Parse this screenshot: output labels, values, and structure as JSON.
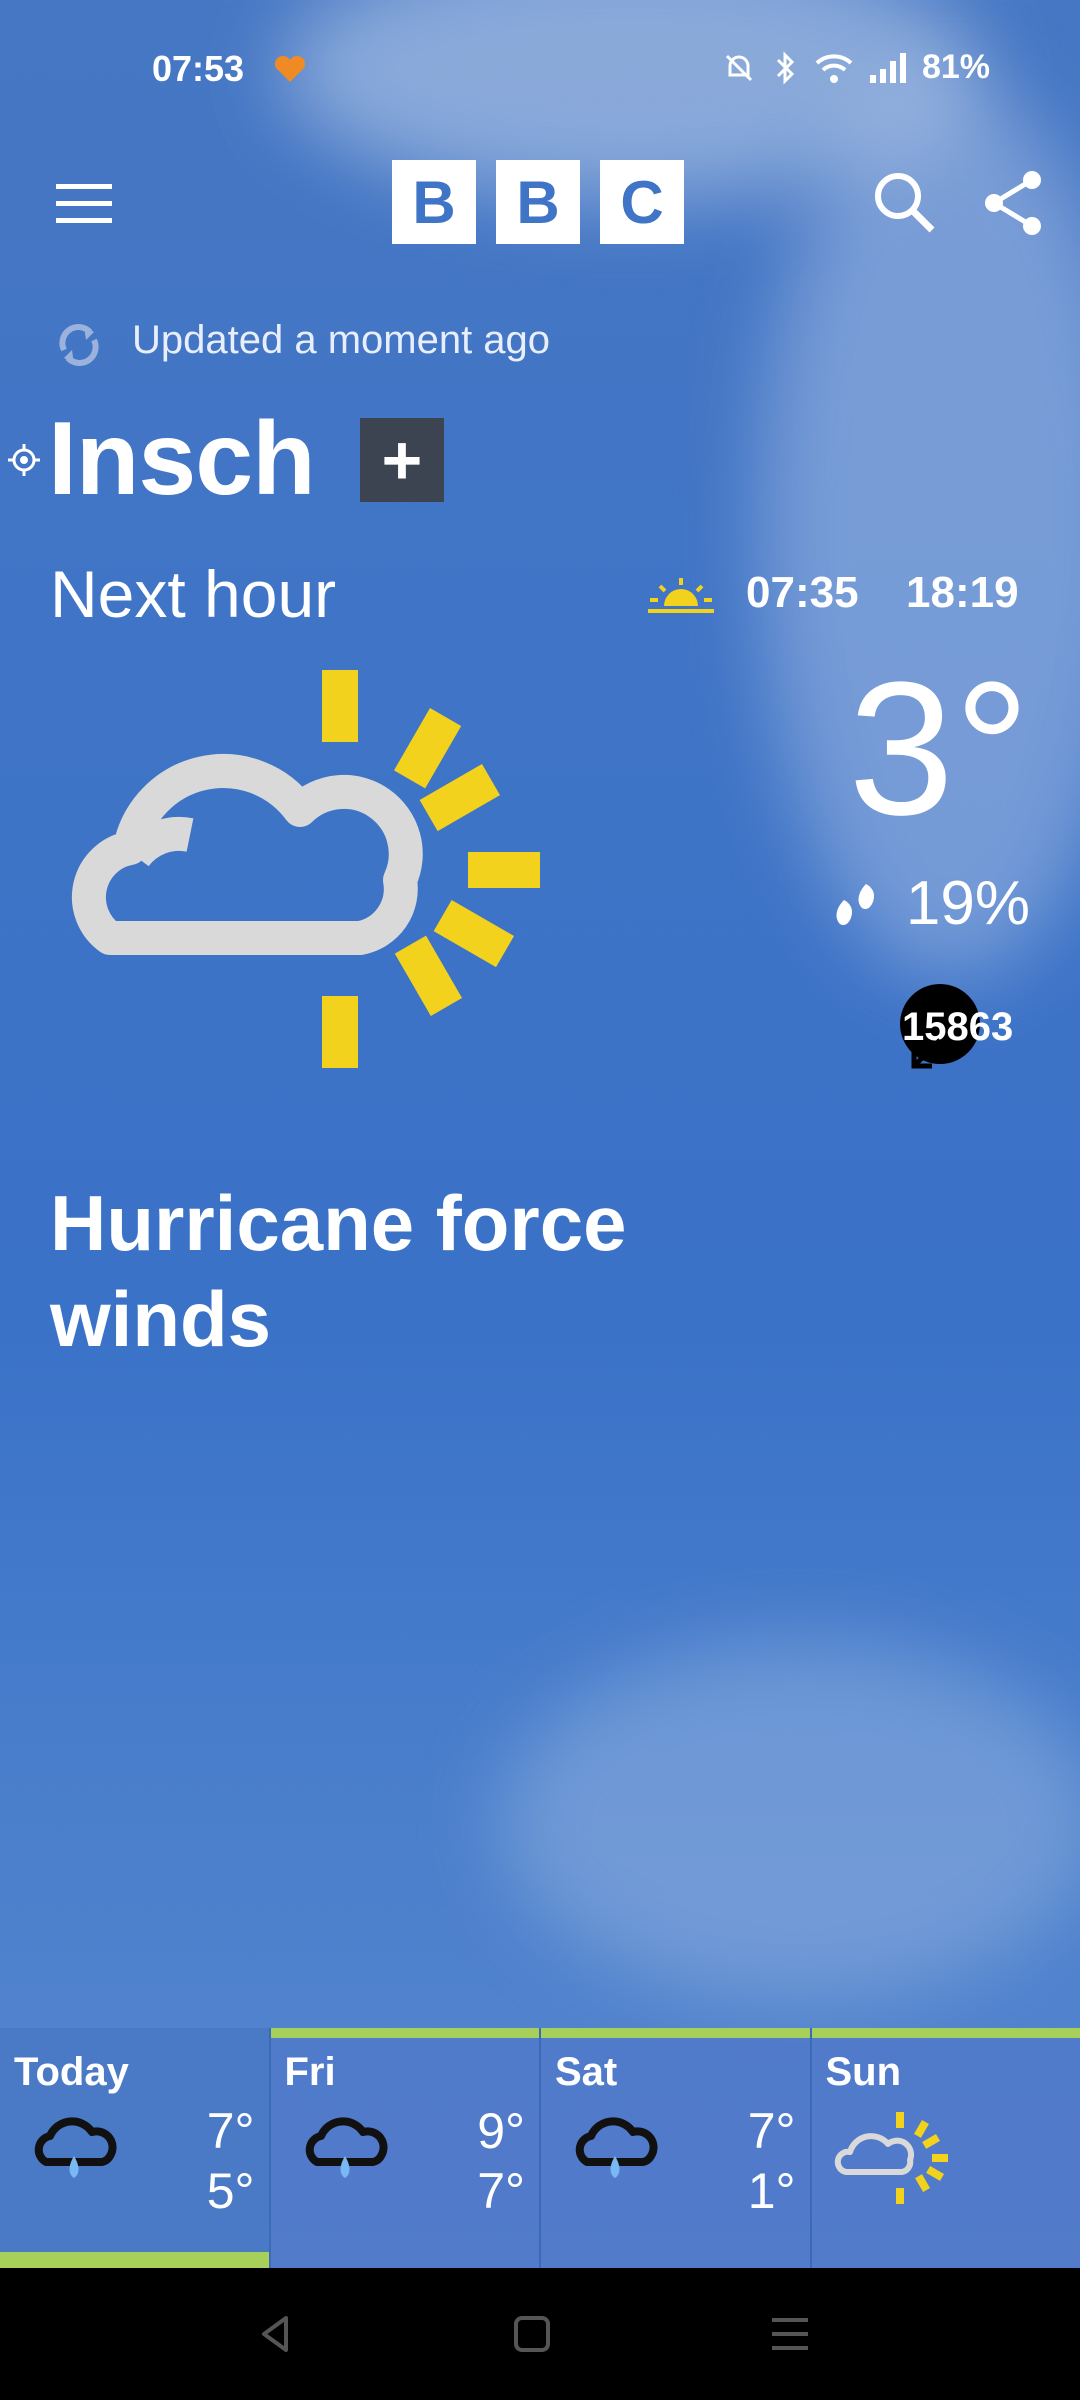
{
  "status_bar": {
    "time": "07:53",
    "battery": "81%"
  },
  "header": {
    "logo_letters": [
      "B",
      "B",
      "C"
    ]
  },
  "location": {
    "updated": "Updated a moment ago",
    "name": "Insch",
    "add_label": "+"
  },
  "current": {
    "period_label": "Next hour",
    "sunrise": "07:35",
    "sunset": "18:19",
    "temperature": "3°",
    "precip_chance": "19%",
    "wind_number": "15863",
    "headline": "Hurricane force winds"
  },
  "forecast": [
    {
      "day": "Today",
      "high": "7°",
      "low": "5°",
      "icon": "rain-cloud-icon"
    },
    {
      "day": "Fri",
      "high": "9°",
      "low": "7°",
      "icon": "rain-cloud-icon"
    },
    {
      "day": "Sat",
      "high": "7°",
      "low": "1°",
      "icon": "rain-cloud-icon"
    },
    {
      "day": "Sun",
      "high": "",
      "low": "",
      "icon": "sun-cloud-icon"
    }
  ],
  "colors": {
    "sky": "#3f74c6",
    "sun_yellow": "#f2d21c",
    "cloud_grey": "#d9d9d9",
    "accent_green": "#a6d05a"
  }
}
